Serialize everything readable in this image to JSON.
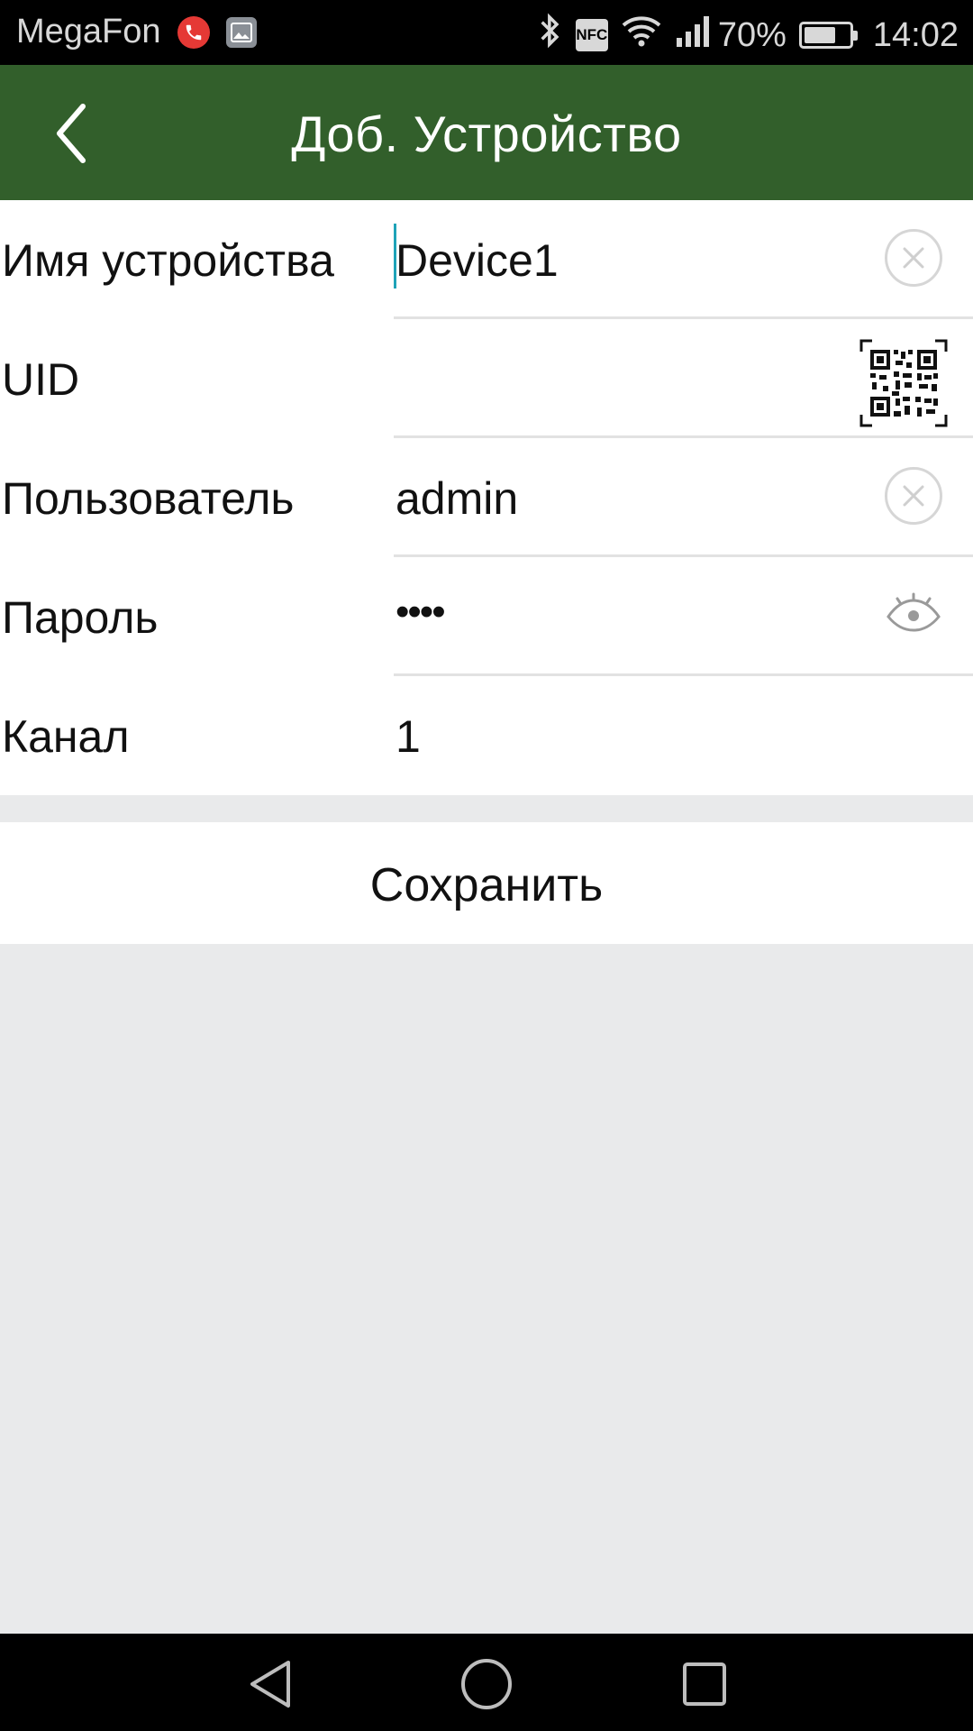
{
  "status_bar": {
    "carrier": "MegaFon",
    "battery_percent": "70%",
    "battery_level": 0.7,
    "time": "14:02",
    "nfc_label": "NFC",
    "icons": [
      "call-icon",
      "gallery-icon",
      "bluetooth-icon",
      "nfc-icon",
      "wifi-icon",
      "signal-icon",
      "battery-icon"
    ]
  },
  "app_bar": {
    "title": "Доб. Устройство",
    "back_icon": "chevron-left-icon"
  },
  "form": {
    "fields": [
      {
        "label": "Имя устройства",
        "value": "Device1",
        "action_icon": "clear-icon"
      },
      {
        "label": "UID",
        "value": "",
        "action_icon": "qr-code-icon"
      },
      {
        "label": "Пользователь",
        "value": "admin",
        "action_icon": "clear-icon"
      },
      {
        "label": "Пароль",
        "value": "••••",
        "action_icon": "eye-icon"
      },
      {
        "label": "Канал",
        "value": "1",
        "action_icon": ""
      }
    ]
  },
  "save_button": {
    "label": "Сохранить"
  },
  "nav_bar": {
    "icons": [
      "back-triangle-icon",
      "home-circle-icon",
      "recents-square-icon"
    ]
  },
  "colors": {
    "app_bar": "#325f2b",
    "background": "#e9eaeb",
    "cursor": "#1fa3b8"
  }
}
